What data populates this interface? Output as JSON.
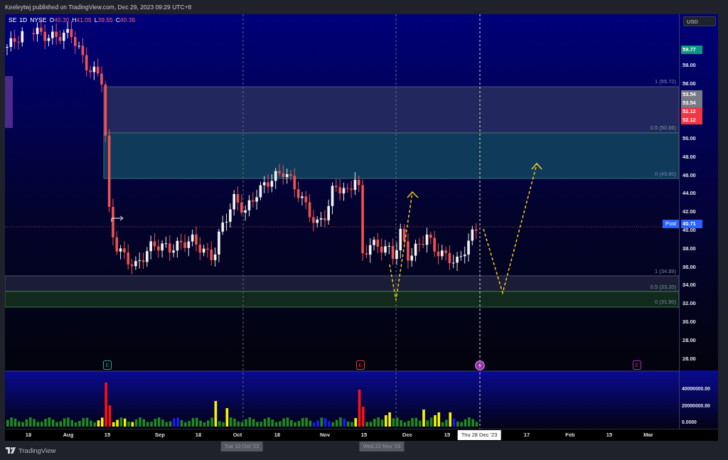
{
  "header": {
    "text": "Keeleytwj published on TradingView.com, Dec 29, 2023 09:29 UTC+8"
  },
  "legend": {
    "symbol": "SE",
    "interval": "1D",
    "exchange": "NYSE",
    "ohlc": [
      {
        "label": "O",
        "value": "40.30"
      },
      {
        "label": "H",
        "value": "41.05"
      },
      {
        "label": "L",
        "value": "39.55"
      },
      {
        "label": "C",
        "value": "40.36"
      }
    ]
  },
  "currency_button": "USD",
  "price_scale": [
    "58.00",
    "56.00",
    "50.00",
    "48.00",
    "46.00",
    "44.00",
    "42.00",
    "40.00",
    "38.00",
    "36.00",
    "34.00",
    "32.00",
    "30.00",
    "28.00",
    "26.00"
  ],
  "price_tags": [
    {
      "text": "59.77",
      "color": "#089981"
    },
    {
      "text": "53.54",
      "color": "#787b86"
    },
    {
      "text": "53.54",
      "color": "#787b86"
    },
    {
      "text": "52.12",
      "color": "#f23645"
    },
    {
      "text": "52.12",
      "color": "#f23645"
    }
  ],
  "post_tag": {
    "label": "Post",
    "value": "40.71"
  },
  "fib_upper": [
    "1 (55.72)",
    "0.5 (50.66)",
    "0 (45.60)"
  ],
  "fib_lower": [
    "1 (34.89)",
    "0.5 (33.20)",
    "0 (31.50)"
  ],
  "events": [
    {
      "kind": "earnings",
      "label": "E",
      "color": "#26a69a"
    },
    {
      "kind": "earnings",
      "label": "E",
      "color": "#f23645"
    },
    {
      "kind": "dividend",
      "color": "#9c27b0"
    },
    {
      "kind": "earnings",
      "label": "E",
      "color": "#b026c8"
    }
  ],
  "volume_scale": [
    "40000000.00",
    "20000000.00",
    "0.0000"
  ],
  "time_axis": [
    "18",
    "Aug",
    "15",
    "Sep",
    "18",
    "Oct",
    "16",
    "Nov",
    "15",
    "Dec",
    "15",
    "17",
    "Feb",
    "15",
    "Mar"
  ],
  "time_highlights": [
    {
      "text": "Tue 10 Oct '23",
      "selected": false
    },
    {
      "text": "Wed 22 Nov '23",
      "selected": false
    },
    {
      "text": "Thu 28 Dec '23",
      "selected": true
    }
  ],
  "footer": {
    "brand": "TradingView"
  }
}
